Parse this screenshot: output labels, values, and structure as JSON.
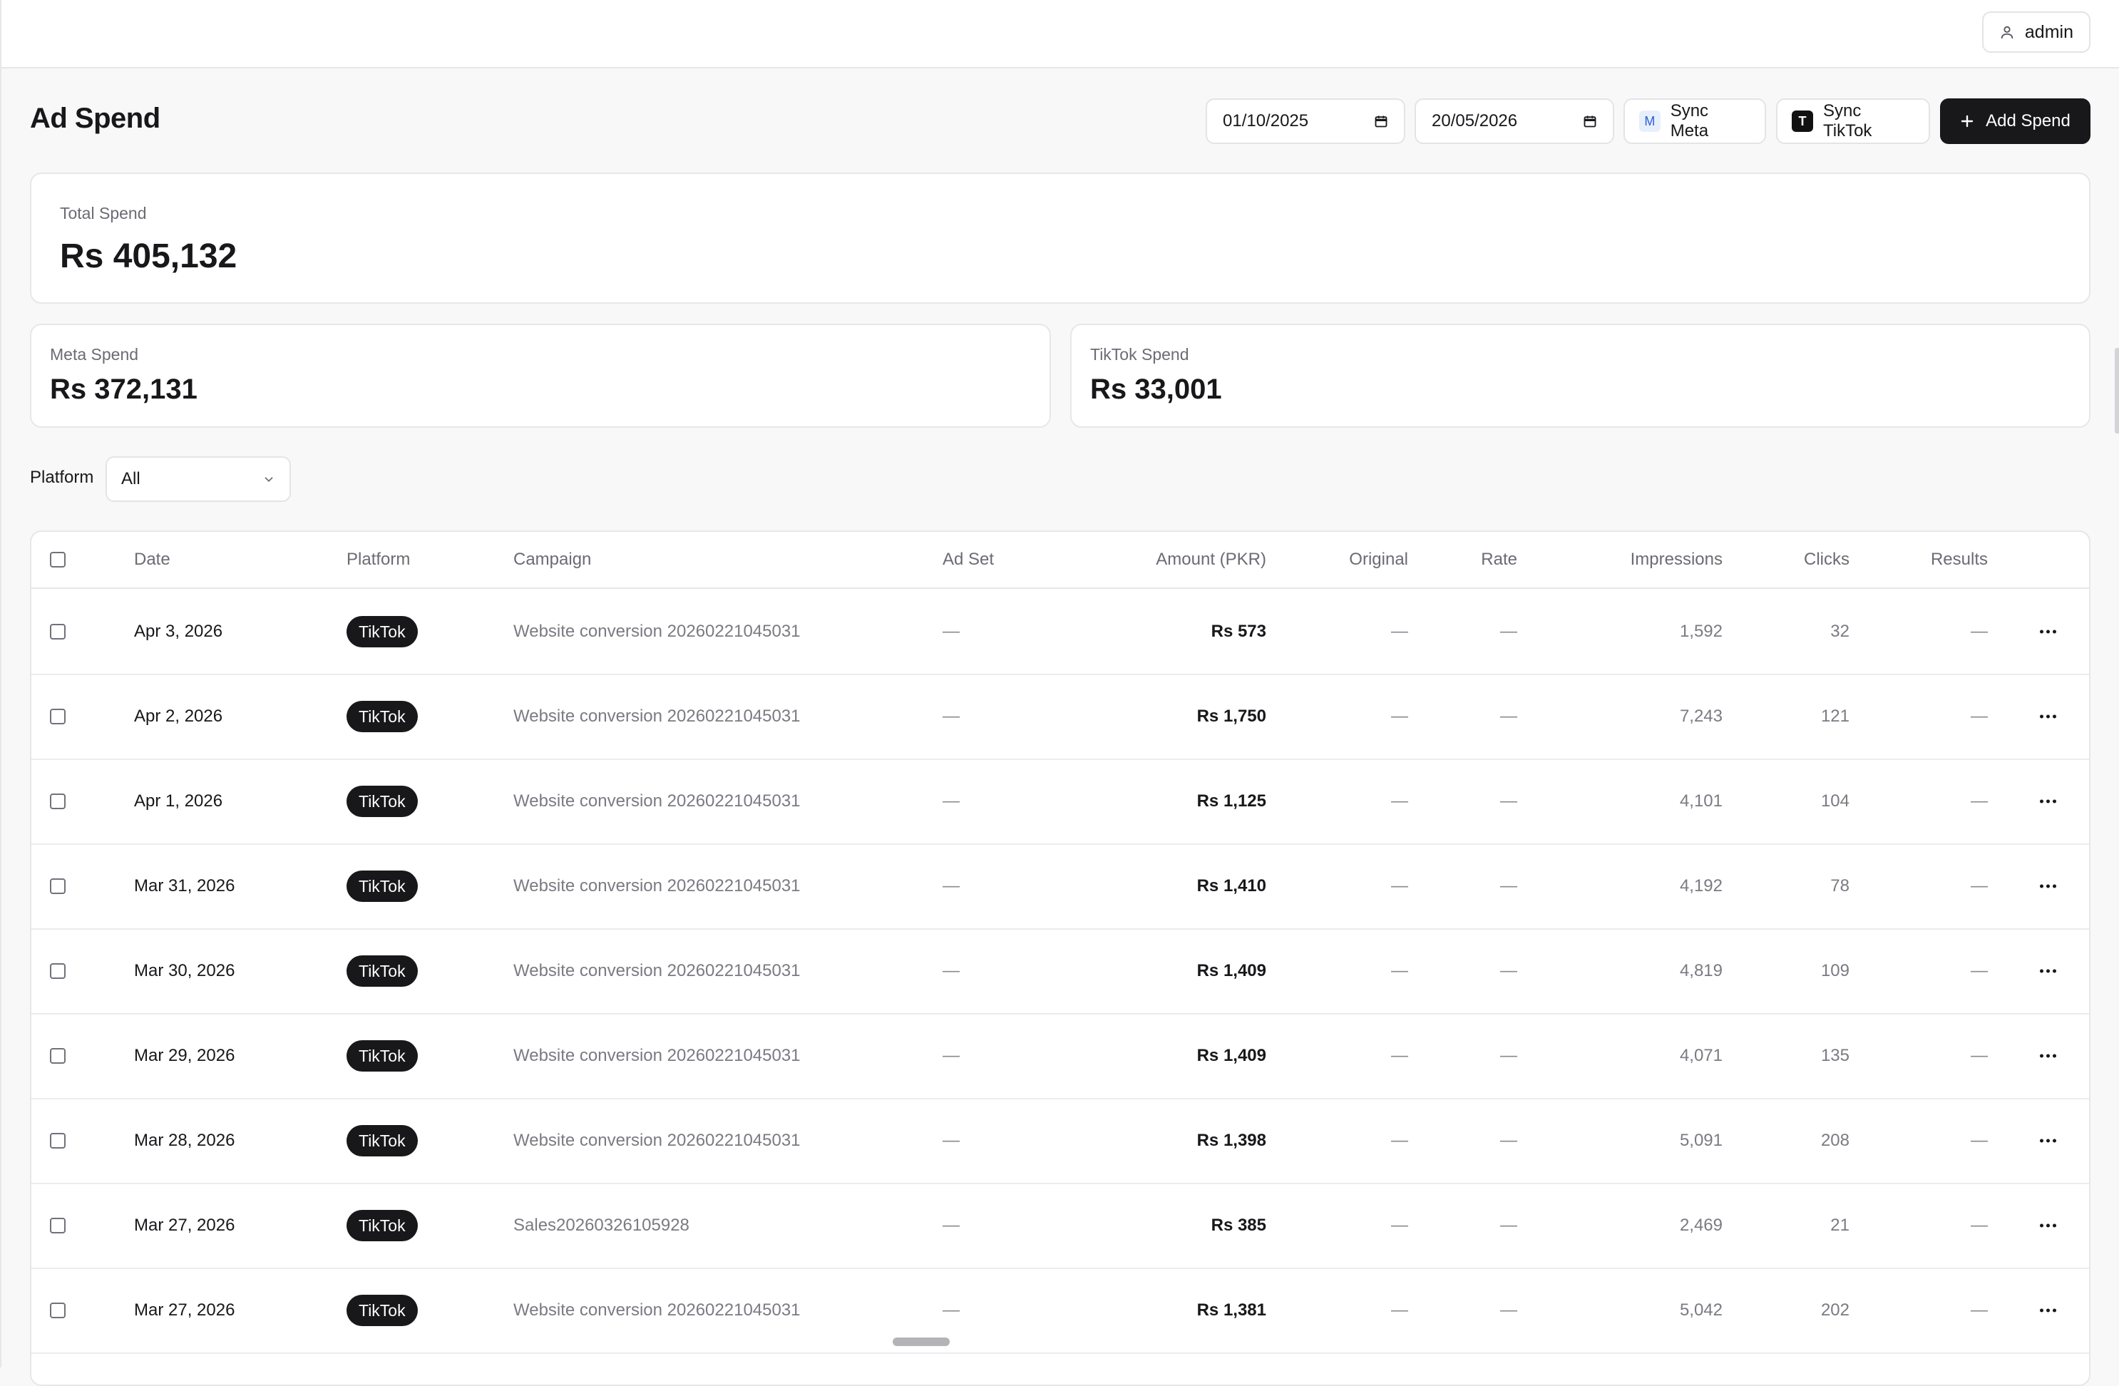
{
  "header": {
    "user": "admin"
  },
  "page": {
    "title": "Ad Spend"
  },
  "filters": {
    "date_from": "01/10/2025",
    "date_to": "20/05/2026",
    "platform_label": "Platform",
    "platform_value": "All"
  },
  "actions": {
    "sync_meta": {
      "badge": "M",
      "label": "Sync Meta"
    },
    "sync_tiktok": {
      "badge": "T",
      "label": "Sync TikTok"
    },
    "add_spend": "Add Spend"
  },
  "summary": {
    "total": {
      "label": "Total Spend",
      "value": "Rs 405,132"
    },
    "meta": {
      "label": "Meta Spend",
      "value": "Rs 372,131"
    },
    "tiktok": {
      "label": "TikTok Spend",
      "value": "Rs 33,001"
    }
  },
  "table": {
    "columns": [
      "Date",
      "Platform",
      "Campaign",
      "Ad Set",
      "Amount (PKR)",
      "Original",
      "Rate",
      "Impressions",
      "Clicks",
      "Results"
    ],
    "rows": [
      {
        "date": "Apr 3, 2026",
        "platform": "TikTok",
        "campaign": "Website conversion 20260221045031",
        "adset": "—",
        "amount": "Rs 573",
        "original": "—",
        "rate": "—",
        "impressions": "1,592",
        "clicks": "32",
        "results": "—"
      },
      {
        "date": "Apr 2, 2026",
        "platform": "TikTok",
        "campaign": "Website conversion 20260221045031",
        "adset": "—",
        "amount": "Rs 1,750",
        "original": "—",
        "rate": "—",
        "impressions": "7,243",
        "clicks": "121",
        "results": "—"
      },
      {
        "date": "Apr 1, 2026",
        "platform": "TikTok",
        "campaign": "Website conversion 20260221045031",
        "adset": "—",
        "amount": "Rs 1,125",
        "original": "—",
        "rate": "—",
        "impressions": "4,101",
        "clicks": "104",
        "results": "—"
      },
      {
        "date": "Mar 31, 2026",
        "platform": "TikTok",
        "campaign": "Website conversion 20260221045031",
        "adset": "—",
        "amount": "Rs 1,410",
        "original": "—",
        "rate": "—",
        "impressions": "4,192",
        "clicks": "78",
        "results": "—"
      },
      {
        "date": "Mar 30, 2026",
        "platform": "TikTok",
        "campaign": "Website conversion 20260221045031",
        "adset": "—",
        "amount": "Rs 1,409",
        "original": "—",
        "rate": "—",
        "impressions": "4,819",
        "clicks": "109",
        "results": "—"
      },
      {
        "date": "Mar 29, 2026",
        "platform": "TikTok",
        "campaign": "Website conversion 20260221045031",
        "adset": "—",
        "amount": "Rs 1,409",
        "original": "—",
        "rate": "—",
        "impressions": "4,071",
        "clicks": "135",
        "results": "—"
      },
      {
        "date": "Mar 28, 2026",
        "platform": "TikTok",
        "campaign": "Website conversion 20260221045031",
        "adset": "—",
        "amount": "Rs 1,398",
        "original": "—",
        "rate": "—",
        "impressions": "5,091",
        "clicks": "208",
        "results": "—"
      },
      {
        "date": "Mar 27, 2026",
        "platform": "TikTok",
        "campaign": "Sales20260326105928",
        "adset": "—",
        "amount": "Rs 385",
        "original": "—",
        "rate": "—",
        "impressions": "2,469",
        "clicks": "21",
        "results": "—"
      },
      {
        "date": "Mar 27, 2026",
        "platform": "TikTok",
        "campaign": "Website conversion 20260221045031",
        "adset": "—",
        "amount": "Rs 1,381",
        "original": "—",
        "rate": "—",
        "impressions": "5,042",
        "clicks": "202",
        "results": "—"
      }
    ]
  }
}
